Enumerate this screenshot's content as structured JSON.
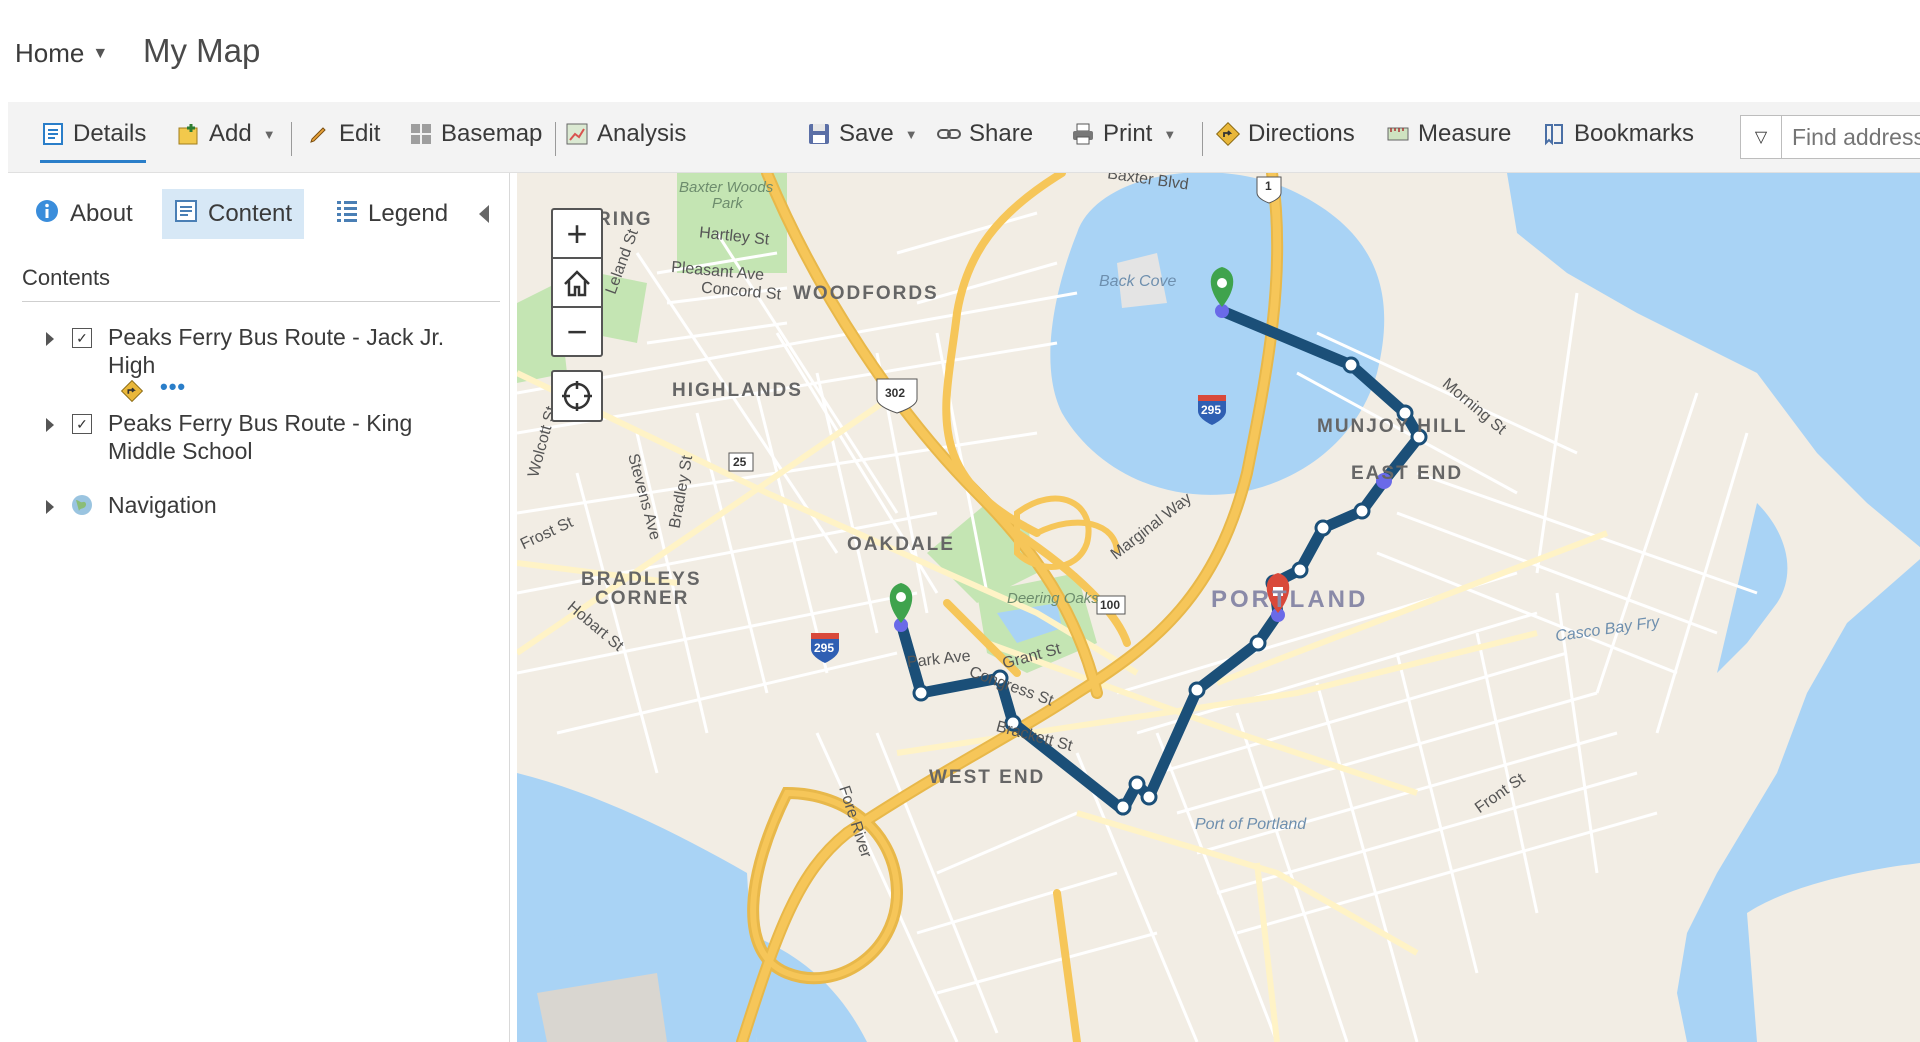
{
  "header": {
    "home_label": "Home",
    "map_title": "My Map"
  },
  "toolbar": {
    "details": "Details",
    "add": "Add",
    "edit": "Edit",
    "basemap": "Basemap",
    "analysis": "Analysis",
    "save": "Save",
    "share": "Share",
    "print": "Print",
    "directions": "Directions",
    "measure": "Measure",
    "bookmarks": "Bookmarks",
    "find_placeholder": "Find address or place"
  },
  "sidebar": {
    "tabs": [
      "About",
      "Content",
      "Legend"
    ],
    "active_tab": "Content",
    "contents_heading": "Contents",
    "layers": [
      {
        "name": "Peaks Ferry Bus Route - Jack Jr. High",
        "checked": true
      },
      {
        "name": "Peaks Ferry Bus Route - King Middle School",
        "checked": true
      },
      {
        "name": "Navigation",
        "checked": false
      }
    ]
  },
  "map": {
    "labels": {
      "ring": "RING",
      "woodfords": "WOODFORDS",
      "highlands": "HIGHLANDS",
      "oakdale": "OAKDALE",
      "bradleys": "BRADLEYS",
      "corner": "CORNER",
      "west_end": "WEST END",
      "portland": "PORTLAND",
      "munjoy_hill": "MUNJOY HILL",
      "east_end": "EAST END",
      "baxter_blvd": "Baxter Blvd",
      "hartley": "Hartley St",
      "pleasant": "Pleasant Ave",
      "concord": "Concord St",
      "leland": "Leland St",
      "frost": "Frost St",
      "stevens": "Stevens Ave",
      "bradley": "Bradley St",
      "hobart": "Hobart St",
      "wolcott": "Wolcott St",
      "park_ave": "Park Ave",
      "congress": "Congress St",
      "grant": "Grant St",
      "brackett": "Brackett St",
      "fore_river": "Fore River",
      "marginal": "Marginal Way",
      "morning": "Morning St",
      "front": "Front St",
      "back_cove": "Back Cove",
      "baxter_woods": "Baxter Woods Park",
      "baxter_woods_1": "Baxter Woods",
      "baxter_woods_2": "Park",
      "deering_oaks": "Deering Oaks",
      "port_of_portland": "Port of Portland",
      "casco_bay": "Casco Bay Fry",
      "rt1": "1",
      "rt302": "302",
      "rt295a": "295",
      "rt295b": "295",
      "rt25": "25",
      "rt100": "100"
    },
    "colors": {
      "water": "#a9d3f5",
      "park": "#c4e5b3",
      "highway": "#f6c659",
      "route": "#1b4f78",
      "start_marker": "#3fa34d",
      "end_marker": "#d9493a"
    }
  }
}
